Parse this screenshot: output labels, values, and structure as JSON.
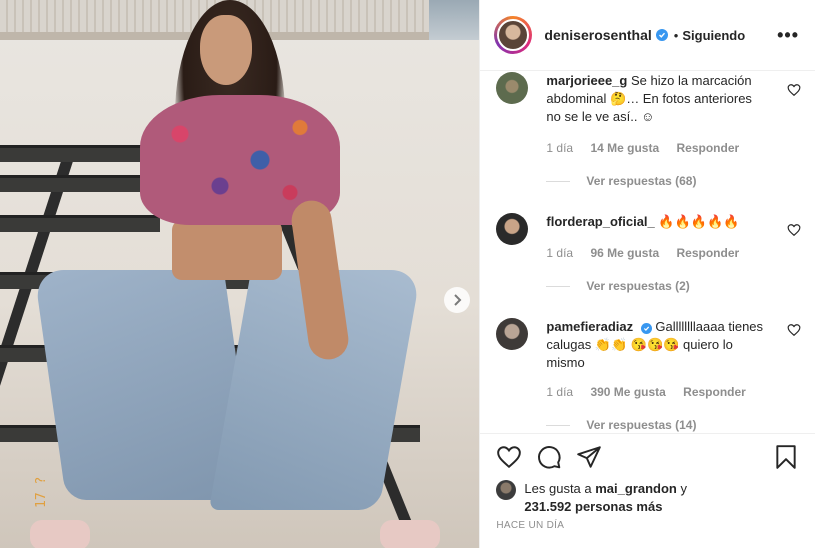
{
  "post": {
    "photo_stamp": "17 ?",
    "next_label": "›"
  },
  "header": {
    "username": "deniserosenthal",
    "separator": "•",
    "follow_status": "Siguiendo",
    "more_label": "•••"
  },
  "comments": [
    {
      "user": "marjorieee_g",
      "verified": false,
      "text": "Se hizo la marcación abdominal 🤔… En fotos anteriores no se le ve así.. ☺",
      "time": "1 día",
      "likes": "14 Me gusta",
      "reply": "Responder",
      "replies": "Ver respuestas (68)"
    },
    {
      "user": "florderap_oficial_",
      "verified": false,
      "text": "🔥🔥🔥🔥🔥",
      "time": "1 día",
      "likes": "96 Me gusta",
      "reply": "Responder",
      "replies": "Ver respuestas (2)"
    },
    {
      "user": "pamefieradiaz",
      "verified": true,
      "text": "Gallllllllaaaa tienes calugas 👏👏 😘😘😘 quiero lo mismo",
      "time": "1 día",
      "likes": "390 Me gusta",
      "reply": "Responder",
      "replies": "Ver respuestas (14)"
    }
  ],
  "actions": {
    "like": "heart-icon",
    "comment": "comment-icon",
    "share": "share-icon",
    "save": "bookmark-icon"
  },
  "likes_summary": {
    "prefix": "Les gusta a",
    "user": "mai_grandon",
    "conj": "y",
    "count": "231.592 personas más"
  },
  "timestamp": "HACE UN DÍA",
  "colors": {
    "verified": "#3897f0",
    "muted": "#8e8e8e",
    "text": "#262626"
  }
}
